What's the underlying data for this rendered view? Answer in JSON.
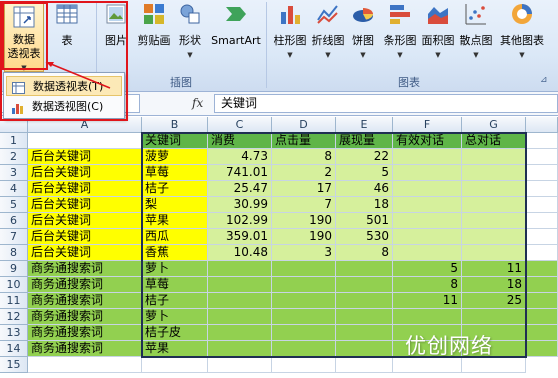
{
  "ribbon": {
    "pivot_label_1": "数据",
    "pivot_label_2": "透视表",
    "table_label": "表",
    "picture_label": "图片",
    "clipart_label": "剪贴画",
    "shapes_label": "形状",
    "smartart_label": "SmartArt",
    "illustrations_group": "插图",
    "column_chart_label": "柱形图",
    "line_chart_label": "折线图",
    "pie_chart_label": "饼图",
    "bar_chart_label": "条形图",
    "area_chart_label": "面积图",
    "scatter_chart_label": "散点图",
    "other_chart_label": "其他图表",
    "charts_group": "图表"
  },
  "menu": {
    "item1": "数据透视表(T)",
    "item2": "数据透视图(C)"
  },
  "formula_bar": {
    "fx": "fx",
    "value": "关键词"
  },
  "columns": [
    "A",
    "B",
    "C",
    "D",
    "E",
    "F",
    "G"
  ],
  "rows": [
    "1",
    "2",
    "3",
    "4",
    "5",
    "6",
    "7",
    "8",
    "9",
    "10",
    "11",
    "12",
    "13",
    "14",
    "15"
  ],
  "sheet": {
    "headers": [
      "",
      "关键词",
      "消费",
      "点击量",
      "展现量",
      "有效对话",
      "总对话"
    ],
    "data": [
      [
        "后台关键词",
        "菠萝",
        "4.73",
        "8",
        "22",
        "",
        ""
      ],
      [
        "后台关键词",
        "草莓",
        "741.01",
        "2",
        "5",
        "",
        ""
      ],
      [
        "后台关键词",
        "桔子",
        "25.47",
        "17",
        "46",
        "",
        ""
      ],
      [
        "后台关键词",
        "梨",
        "30.99",
        "7",
        "18",
        "",
        ""
      ],
      [
        "后台关键词",
        "苹果",
        "102.99",
        "190",
        "501",
        "",
        ""
      ],
      [
        "后台关键词",
        "西瓜",
        "359.01",
        "190",
        "530",
        "",
        ""
      ],
      [
        "后台关键词",
        "香蕉",
        "10.48",
        "3",
        "8",
        "",
        ""
      ],
      [
        "商务通搜索词",
        "萝卜",
        "",
        "",
        "",
        "5",
        "11"
      ],
      [
        "商务通搜索词",
        "草莓",
        "",
        "",
        "",
        "8",
        "18"
      ],
      [
        "商务通搜索词",
        "桔子",
        "",
        "",
        "",
        "11",
        "25"
      ],
      [
        "商务通搜索词",
        "萝卜",
        "",
        "",
        "",
        "",
        ""
      ],
      [
        "商务通搜索词",
        "桔子皮",
        "",
        "",
        "",
        "",
        ""
      ],
      [
        "商务通搜索词",
        "苹果",
        "",
        "",
        "",
        "",
        ""
      ]
    ]
  },
  "watermark": "优创网络",
  "colors": {
    "yellow": "#ffff00",
    "lightgreen": "#d6f09c",
    "green": "#92d050",
    "header_green": "#5fb548",
    "red": "#e0151b"
  }
}
